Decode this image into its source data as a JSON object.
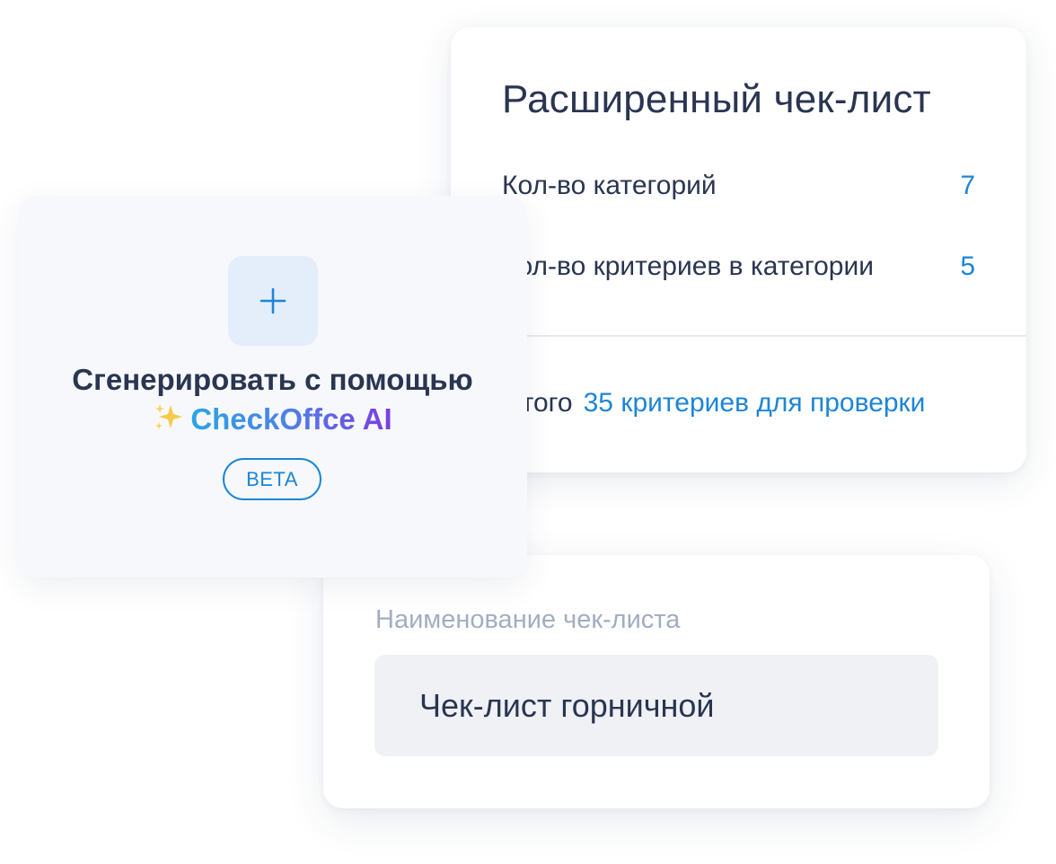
{
  "extended_checklist": {
    "title": "Расширенный чек-лист",
    "rows": [
      {
        "label": "Кол-во категорий",
        "value": "7"
      },
      {
        "label": "Кол-во критериев в категории",
        "value": "5"
      }
    ],
    "total_label": "Итого",
    "total_value": "35 критериев для проверки"
  },
  "checklist_name": {
    "label": "Наименование чек-листа",
    "value": "Чек-лист горничной"
  },
  "ai_generate": {
    "title": "Сгенерировать с помощью",
    "brand": "CheckOffce AI",
    "badge": "BETA"
  },
  "colors": {
    "primary_text": "#2a3551",
    "accent_blue": "#1d85d8",
    "muted_label": "#a3adc1",
    "brand_gradient": [
      "#29a6e6",
      "#7b3ce6"
    ]
  },
  "icons": {
    "plus": "plus-icon",
    "sparkles": "sparkles-icon"
  }
}
